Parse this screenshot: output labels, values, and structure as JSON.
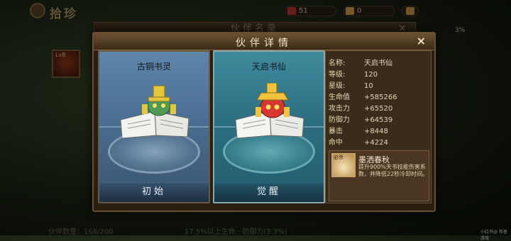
{
  "background": {
    "title": "拾珍",
    "resource_1": "51",
    "resource_2": "0",
    "panel_title": "伙伴名录",
    "close_glyph": "×",
    "portrait_level": "Lv8",
    "percent": "3%",
    "partner_count": "伙伴数量：168/200",
    "footer_text": "17.5%以上生命 · 防御力(3.3%)",
    "watermark": "小红书@ 布普游戏"
  },
  "dialog": {
    "title": "伙伴详情",
    "close_glyph": "×"
  },
  "cards": [
    {
      "name": "古铜书灵",
      "stage": "初始"
    },
    {
      "name": "天启书仙",
      "stage": "觉醒"
    }
  ],
  "stats": [
    {
      "key": "名称:",
      "value": "天启书仙"
    },
    {
      "key": "等级:",
      "value": "120"
    },
    {
      "key": "星级:",
      "value": "10"
    },
    {
      "key": "生命值",
      "value": "+585266"
    },
    {
      "key": "攻击力",
      "value": "+65520"
    },
    {
      "key": "防御力",
      "value": "+64539"
    },
    {
      "key": "暴击",
      "value": "+8448"
    },
    {
      "key": "命中",
      "value": "+4224"
    }
  ],
  "skill": {
    "icon": "book-skill-icon",
    "icon_badge": "必杀",
    "name": "墨洒春秋",
    "description": "提升900%天书技能伤害系数，并降低22秒冷却时间。"
  },
  "colors": {
    "dialog_bg": "#2a1e12",
    "card_initial": "#4a6f92",
    "card_awakened": "#2c6f82",
    "text": "#e4d6b6"
  }
}
